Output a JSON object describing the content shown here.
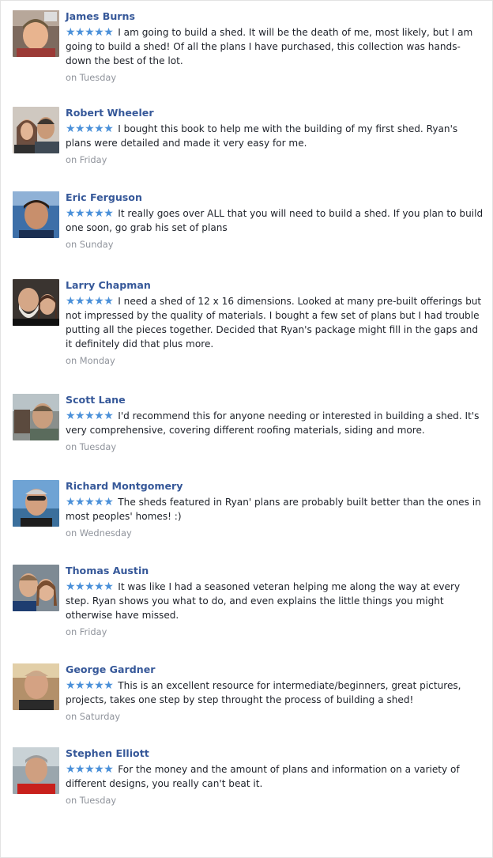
{
  "reviews": [
    {
      "name": "James Burns",
      "stars": "★★★★★",
      "text": "I am going to build a shed. It will be the death of me, most likely, but I am going to build a shed! Of all the plans I have purchased, this collection was hands-down the best of the lot.",
      "time": "on Tuesday"
    },
    {
      "name": "Robert Wheeler",
      "stars": "★★★★★",
      "text": "I bought this book to help me with the building of my first shed. Ryan's plans were detailed and made it very easy for me.",
      "time": "on Friday"
    },
    {
      "name": "Eric Ferguson",
      "stars": "★★★★★",
      "text": "It really goes over ALL that you will need to build a shed. If you plan to build one soon, go grab his set of plans",
      "time": "on Sunday"
    },
    {
      "name": "Larry Chapman",
      "stars": "★★★★★",
      "text": "I need a shed of 12 x 16 dimensions. Looked at many pre-built offerings but not impressed by the quality of materials. I bought a few set of plans but I had trouble putting all the pieces together. Decided that Ryan's package might fill in the gaps and it definitely did that plus more.",
      "time": "on Monday"
    },
    {
      "name": "Scott Lane",
      "stars": "★★★★★",
      "text": "I'd recommend this for anyone needing or interested in building a shed. It's very comprehensive, covering different roofing materials, siding and more.",
      "time": "on Tuesday"
    },
    {
      "name": "Richard Montgomery",
      "stars": "★★★★★",
      "text": "The sheds featured in Ryan' plans are probably built better than the ones in most peoples' homes! :)",
      "time": "on Wednesday"
    },
    {
      "name": "Thomas Austin",
      "stars": "★★★★★",
      "text": "It was like I had a seasoned veteran helping me along the way at every step. Ryan shows you what to do, and even explains the little things you might otherwise have missed.",
      "time": "on Friday"
    },
    {
      "name": "George Gardner",
      "stars": "★★★★★",
      "text": "This is an excellent resource for intermediate/beginners, great pictures, projects, takes one step by step throught the process of building a shed!",
      "time": "on Saturday"
    },
    {
      "name": "Stephen Elliott",
      "stars": "★★★★★",
      "text": "For the money and the amount of plans and information on a variety of different designs, you really can't beat it.",
      "time": "on Tuesday"
    }
  ],
  "colors": {
    "name": "#365899",
    "star": "#4a90d9",
    "text": "#1d2129",
    "time": "#90949c"
  }
}
